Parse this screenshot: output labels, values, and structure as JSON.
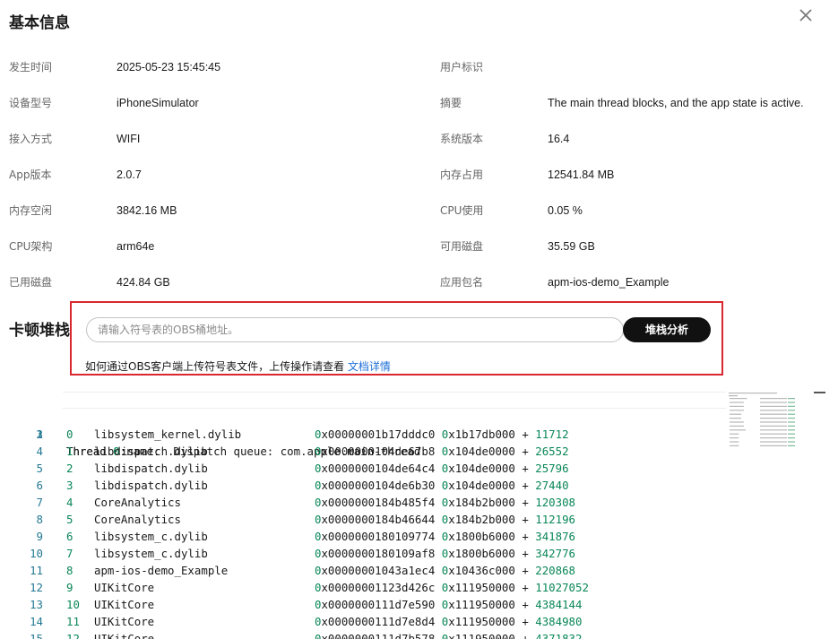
{
  "title": "基本信息",
  "info": [
    {
      "l1": "发生时间",
      "v1": "2025-05-23 15:45:45",
      "l2": "用户标识",
      "v2": ""
    },
    {
      "l1": "设备型号",
      "v1": "iPhoneSimulator",
      "l2": "摘要",
      "v2": "The main thread blocks, and the app state is active."
    },
    {
      "l1": "接入方式",
      "v1": "WIFI",
      "l2": "系统版本",
      "v2": "16.4"
    },
    {
      "l1": "App版本",
      "v1": "2.0.7",
      "l2": "内存占用",
      "v2": "12541.84 MB"
    },
    {
      "l1": "内存空闲",
      "v1": "3842.16 MB",
      "l2": "CPU使用",
      "v2": "0.05 %"
    },
    {
      "l1": "CPU架构",
      "v1": "arm64e",
      "l2": "可用磁盘",
      "v2": "35.59 GB"
    },
    {
      "l1": "已用磁盘",
      "v1": "424.84 GB",
      "l2": "应用包名",
      "v2": "apm-ios-demo_Example"
    }
  ],
  "stack": {
    "title": "卡顿堆栈",
    "placeholder": "请输入符号表的OBS桶地址。",
    "button": "堆栈分析",
    "help_text": "如何通过OBS客户端上传符号表文件，上传操作请查看 ",
    "help_link": "文档详情"
  },
  "code": {
    "line1": {
      "pre": "Thread ",
      "num": "0",
      "post": " name:  Dispatch queue: com.apple.main-thread"
    },
    "line2": {
      "pre": "Thread ",
      "num": "0",
      "post": ":"
    },
    "frames": [
      {
        "ln": "3",
        "idx": "0",
        "lib": "libsystem_kernel.dylib",
        "addr": "x00000001b17dddc0",
        "base": "x1b17db000",
        "off": "11712"
      },
      {
        "ln": "4",
        "idx": "1",
        "lib": "libdispatch.dylib",
        "addr": "x0000000104de67b8",
        "base": "x104de0000",
        "off": "26552"
      },
      {
        "ln": "5",
        "idx": "2",
        "lib": "libdispatch.dylib",
        "addr": "x0000000104de64c4",
        "base": "x104de0000",
        "off": "25796"
      },
      {
        "ln": "6",
        "idx": "3",
        "lib": "libdispatch.dylib",
        "addr": "x0000000104de6b30",
        "base": "x104de0000",
        "off": "27440"
      },
      {
        "ln": "7",
        "idx": "4",
        "lib": "CoreAnalytics",
        "addr": "x0000000184b485f4",
        "base": "x184b2b000",
        "off": "120308"
      },
      {
        "ln": "8",
        "idx": "5",
        "lib": "CoreAnalytics",
        "addr": "x0000000184b46644",
        "base": "x184b2b000",
        "off": "112196"
      },
      {
        "ln": "9",
        "idx": "6",
        "lib": "libsystem_c.dylib",
        "addr": "x0000000180109774",
        "base": "x1800b6000",
        "off": "341876"
      },
      {
        "ln": "10",
        "idx": "7",
        "lib": "libsystem_c.dylib",
        "addr": "x0000000180109af8",
        "base": "x1800b6000",
        "off": "342776"
      },
      {
        "ln": "11",
        "idx": "8",
        "lib": "apm-ios-demo_Example",
        "addr": "x00000001043a1ec4",
        "base": "x10436c000",
        "off": "220868"
      },
      {
        "ln": "12",
        "idx": "9",
        "lib": "UIKitCore",
        "addr": "x00000001123d426c",
        "base": "x111950000",
        "off": "11027052"
      },
      {
        "ln": "13",
        "idx": "10",
        "lib": "UIKitCore",
        "addr": "x0000000111d7e590",
        "base": "x111950000",
        "off": "4384144"
      },
      {
        "ln": "14",
        "idx": "11",
        "lib": "UIKitCore",
        "addr": "x0000000111d7e8d4",
        "base": "x111950000",
        "off": "4384980"
      },
      {
        "ln": "15",
        "idx": "12",
        "lib": "UIKitCore",
        "addr": "x0000000111d7b578",
        "base": "x111950000",
        "off": "4371832"
      }
    ],
    "zero": "0",
    "plus": "+"
  }
}
